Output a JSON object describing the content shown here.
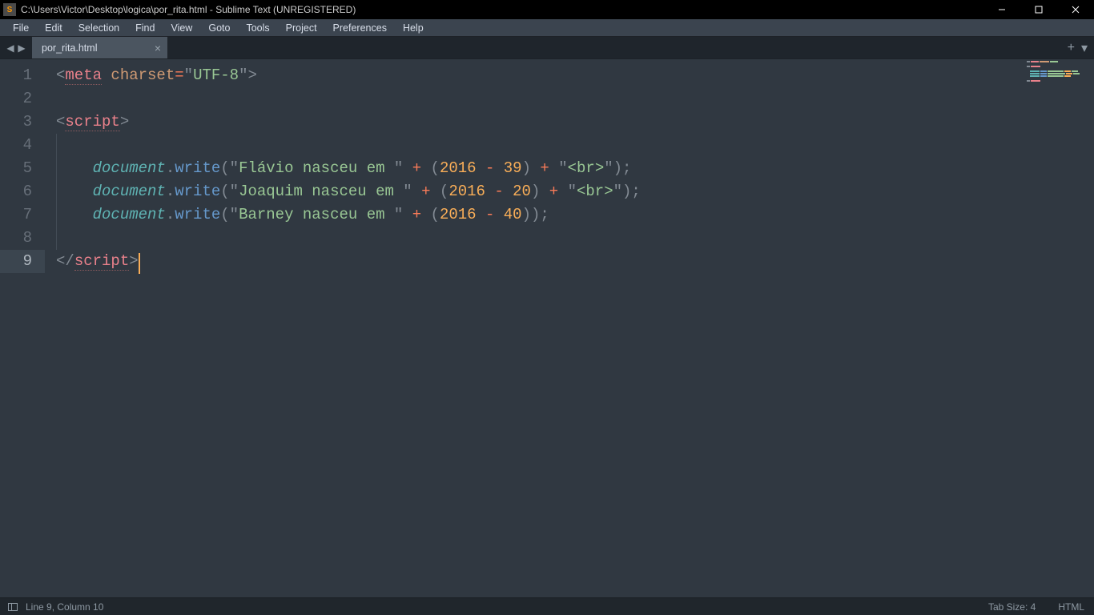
{
  "window": {
    "title": "C:\\Users\\Victor\\Desktop\\logica\\por_rita.html - Sublime Text (UNREGISTERED)"
  },
  "menu": [
    "File",
    "Edit",
    "Selection",
    "Find",
    "View",
    "Goto",
    "Tools",
    "Project",
    "Preferences",
    "Help"
  ],
  "tabs": [
    {
      "label": "por_rita.html"
    }
  ],
  "lines": {
    "numbers": [
      "1",
      "2",
      "3",
      "4",
      "5",
      "6",
      "7",
      "8",
      "9"
    ],
    "current_index": 8
  },
  "code": {
    "l1": {
      "lt": "<",
      "tag": "meta",
      "sp": " ",
      "attr": "charset",
      "eq": "=",
      "q1": "\"",
      "val": "UTF-8",
      "q2": "\"",
      "gt": ">"
    },
    "l3": {
      "lt": "<",
      "tag": "script",
      "gt": ">"
    },
    "l5": {
      "obj": "document",
      "dot": ".",
      "method": "write",
      "lp": "(",
      "q1": "\"",
      "s1": "Flávio nasceu em ",
      "q2": "\"",
      "plus1": " + ",
      "lp2": "(",
      "n1": "2016",
      "minus": " - ",
      "n2": "39",
      "rp2": ")",
      "plus2": " + ",
      "q3": "\"",
      "s2": "<br>",
      "q4": "\"",
      "rp": ")",
      "semi": ";"
    },
    "l6": {
      "obj": "document",
      "dot": ".",
      "method": "write",
      "lp": "(",
      "q1": "\"",
      "s1": "Joaquim nasceu em ",
      "q2": "\"",
      "plus1": " + ",
      "lp2": "(",
      "n1": "2016",
      "minus": " - ",
      "n2": "20",
      "rp2": ")",
      "plus2": " + ",
      "q3": "\"",
      "s2": "<br>",
      "q4": "\"",
      "rp": ")",
      "semi": ";"
    },
    "l7": {
      "obj": "document",
      "dot": ".",
      "method": "write",
      "lp": "(",
      "q1": "\"",
      "s1": "Barney nasceu em ",
      "q2": "\"",
      "plus1": " + ",
      "lp2": "(",
      "n1": "2016",
      "minus": " - ",
      "n2": "40",
      "rp2": ")",
      "rp": ")",
      "semi": ";"
    },
    "l9": {
      "lt": "</",
      "tag": "script",
      "gt": ">"
    }
  },
  "status": {
    "cursor": "Line 9, Column 10",
    "tab_size": "Tab Size: 4",
    "syntax": "HTML"
  }
}
